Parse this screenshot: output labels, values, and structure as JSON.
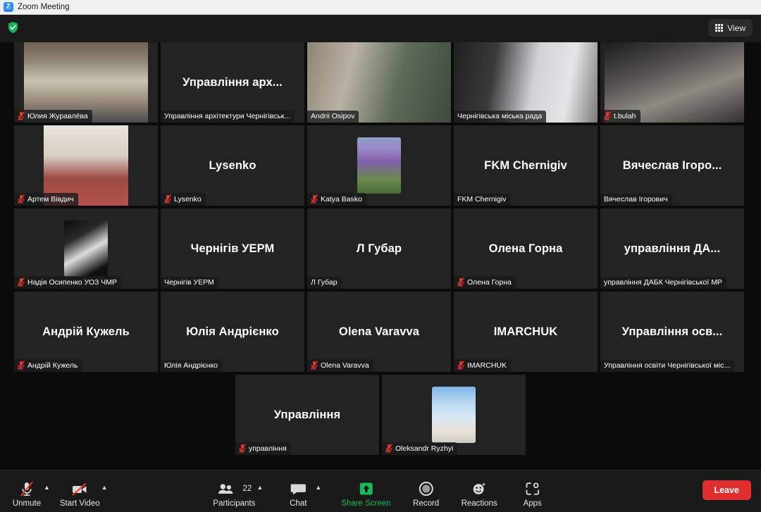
{
  "window": {
    "title": "Zoom Meeting",
    "logo_text": "Z",
    "logo_icon": "zoom-logo-icon"
  },
  "topbar": {
    "encryption_icon": "green-shield-check-icon",
    "view_button": {
      "label": "View",
      "icon": "grid-icon"
    }
  },
  "grid": {
    "rows": [
      [
        {
          "initials": "",
          "name": "Юлия Журавлёва",
          "muted": true,
          "video": true,
          "kind": "video",
          "active": false
        },
        {
          "initials": "Управління арх...",
          "name": "Управління архітектури Чернігівськ...",
          "muted": false,
          "video": false,
          "kind": "name-only",
          "active": false
        },
        {
          "initials": "",
          "name": "Andrii Osipov",
          "muted": false,
          "video": true,
          "kind": "video",
          "active": false
        },
        {
          "initials": "",
          "name": "Чернігівська міська рада",
          "muted": false,
          "video": true,
          "kind": "video",
          "active": true
        },
        {
          "initials": "",
          "name": "t.bulah",
          "muted": true,
          "video": true,
          "kind": "video",
          "active": false
        }
      ],
      [
        {
          "initials": "",
          "name": "Артем Вівдич",
          "muted": true,
          "video": true,
          "kind": "video",
          "active": false
        },
        {
          "initials": "Lysenko",
          "name": "Lysenko",
          "muted": true,
          "video": false,
          "kind": "name-only",
          "active": false
        },
        {
          "initials": "",
          "name": "Katya Basko",
          "muted": true,
          "video": false,
          "kind": "avatar",
          "active": false
        },
        {
          "initials": "FKM Chernigiv",
          "name": "FKM Chernigiv",
          "muted": false,
          "video": false,
          "kind": "name-only",
          "active": false
        },
        {
          "initials": "Вячеслав Ігоро...",
          "name": "Вячеслав Ігорович",
          "muted": false,
          "video": false,
          "kind": "name-only",
          "active": false
        }
      ],
      [
        {
          "initials": "",
          "name": "Надія Осипенко УОЗ ЧМР",
          "muted": true,
          "video": false,
          "kind": "avatar",
          "active": false
        },
        {
          "initials": "Чернігів УЕРМ",
          "name": "Чернігів УЕРМ",
          "muted": false,
          "video": false,
          "kind": "name-only",
          "active": false
        },
        {
          "initials": "Л Губар",
          "name": "Л Губар",
          "muted": false,
          "video": false,
          "kind": "name-only",
          "active": false
        },
        {
          "initials": "Олена Горна",
          "name": "Олена Горна",
          "muted": true,
          "video": false,
          "kind": "name-only",
          "active": false
        },
        {
          "initials": "управління ДА...",
          "name": "управління ДАБК Чернігівської МР",
          "muted": false,
          "video": false,
          "kind": "name-only",
          "active": false
        }
      ],
      [
        {
          "initials": "Андрій Кужель",
          "name": "Андрій Кужель",
          "muted": true,
          "video": false,
          "kind": "name-only",
          "active": false
        },
        {
          "initials": "Юлія Андрієнко",
          "name": "Юлія Андрієнко",
          "muted": false,
          "video": false,
          "kind": "name-only",
          "active": false
        },
        {
          "initials": "Olena Varavva",
          "name": "Olena Varavva",
          "muted": true,
          "video": false,
          "kind": "name-only",
          "active": false
        },
        {
          "initials": "IMARCHUK",
          "name": "IMARCHUK",
          "muted": true,
          "video": false,
          "kind": "name-only",
          "active": false
        },
        {
          "initials": "Управління осв...",
          "name": "Управління освіти Чернігівської міс...",
          "muted": false,
          "video": false,
          "kind": "name-only",
          "active": false
        }
      ],
      [
        {
          "initials": "Управління",
          "name": "управління",
          "muted": true,
          "video": false,
          "kind": "name-only",
          "active": false
        },
        {
          "initials": "",
          "name": "Oleksandr Ryzhyi",
          "muted": true,
          "video": false,
          "kind": "avatar",
          "active": false
        }
      ]
    ]
  },
  "toolbar": {
    "mute": {
      "label": "Unmute",
      "icon": "mic-muted-icon",
      "has_caret": true
    },
    "video": {
      "label": "Start Video",
      "icon": "camera-off-icon",
      "has_caret": true
    },
    "participants": {
      "label": "Participants",
      "icon": "participants-icon",
      "count": "22",
      "has_caret": true
    },
    "chat": {
      "label": "Chat",
      "icon": "chat-bubble-icon",
      "has_caret": true
    },
    "share": {
      "label": "Share Screen",
      "icon": "share-screen-icon",
      "has_caret": false
    },
    "record": {
      "label": "Record",
      "icon": "record-circle-icon",
      "has_caret": false
    },
    "reactions": {
      "label": "Reactions",
      "icon": "reactions-smiley-icon",
      "has_caret": false
    },
    "apps": {
      "label": "Apps",
      "icon": "apps-icon",
      "has_caret": false
    },
    "leave": {
      "label": "Leave"
    }
  },
  "colors": {
    "accent_green": "#19b955",
    "leave_red": "#e02d2d",
    "active_speaker": "#d7f205",
    "mute_red": "#e8392f"
  }
}
